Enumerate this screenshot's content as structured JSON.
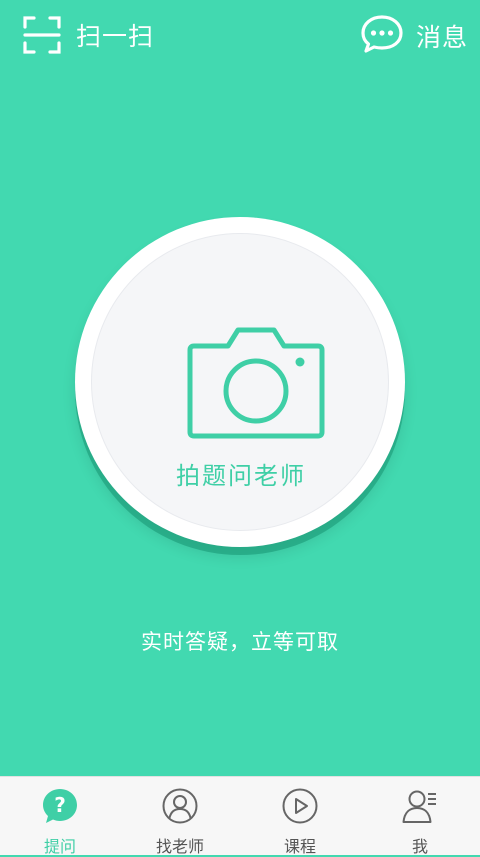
{
  "header": {
    "scan_label": "扫一扫",
    "messages_label": "消息"
  },
  "main": {
    "capture_label": "拍题问老师",
    "subtitle": "实时答疑，立等可取"
  },
  "tabbar": {
    "tabs": [
      {
        "label": "提问",
        "icon": "question-icon",
        "active": true
      },
      {
        "label": "找老师",
        "icon": "teacher-icon",
        "active": false
      },
      {
        "label": "课程",
        "icon": "play-icon",
        "active": false
      },
      {
        "label": "我",
        "icon": "profile-icon",
        "active": false
      }
    ]
  },
  "colors": {
    "brand": "#42d9b0",
    "accent": "#3fcfa6",
    "tabbar_bg": "#f7f7f7"
  }
}
